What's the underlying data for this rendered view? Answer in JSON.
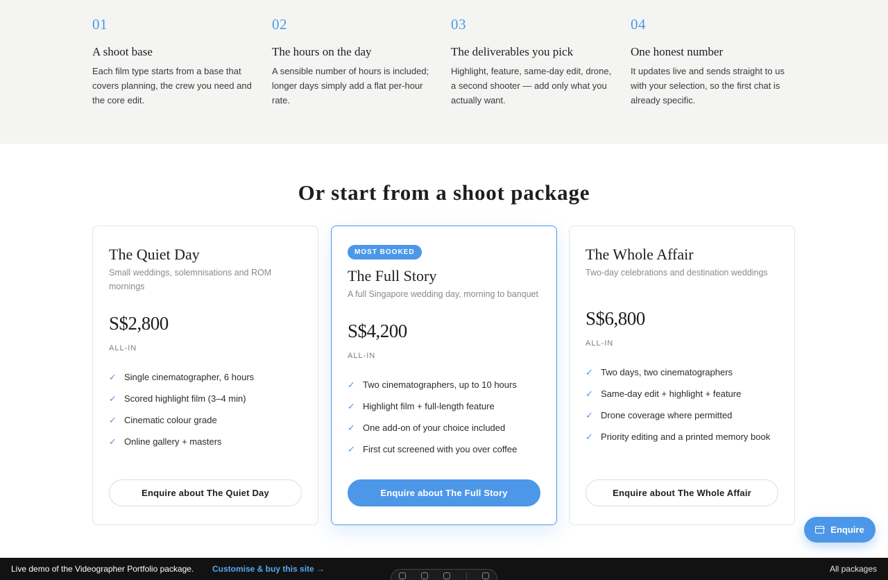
{
  "steps": [
    {
      "num": "01",
      "title": "A shoot base",
      "desc": "Each film type starts from a base that covers planning, the crew you need and the core edit."
    },
    {
      "num": "02",
      "title": "The hours on the day",
      "desc": "A sensible number of hours is included; longer days simply add a flat per-hour rate."
    },
    {
      "num": "03",
      "title": "The deliverables you pick",
      "desc": "Highlight, feature, same-day edit, drone, a second shooter — add only what you actually want."
    },
    {
      "num": "04",
      "title": "One honest number",
      "desc": "It updates live and sends straight to us with your selection, so the first chat is already specific."
    }
  ],
  "packages_title": "Or start from a shoot package",
  "packages": [
    {
      "name": "The Quiet Day",
      "subtitle": "Small weddings, solemnisations and ROM mornings",
      "price": "S$2,800",
      "price_note": "ALL-IN",
      "features": [
        "Single cinematographer, 6 hours",
        "Scored highlight film (3–4 min)",
        "Cinematic colour grade",
        "Online gallery + masters"
      ],
      "cta": "Enquire about The Quiet Day"
    },
    {
      "badge": "MOST BOOKED",
      "name": "The Full Story",
      "subtitle": "A full Singapore wedding day, morning to banquet",
      "price": "S$4,200",
      "price_note": "ALL-IN",
      "features": [
        "Two cinematographers, up to 10 hours",
        "Highlight film + full-length feature",
        "One add-on of your choice included",
        "First cut screened with you over coffee"
      ],
      "cta": "Enquire about The Full Story"
    },
    {
      "name": "The Whole Affair",
      "subtitle": "Two-day celebrations and destination weddings",
      "price": "S$6,800",
      "price_note": "ALL-IN",
      "features": [
        "Two days, two cinematographers",
        "Same-day edit + highlight + feature",
        "Drone coverage where permitted",
        "Priority editing and a printed memory book"
      ],
      "cta": "Enquire about The Whole Affair"
    }
  ],
  "fab": {
    "label": "Enquire",
    "icon": "calendar-icon"
  },
  "bottom_bar": {
    "text": "Live demo of the Videographer Portfolio package.",
    "link": "Customise & buy this site →",
    "right": "All packages"
  },
  "colors": {
    "accent": "#4d97e8",
    "steps_bg": "#f4f4f3",
    "bar_bg": "#121212"
  },
  "check_icon": "✓"
}
